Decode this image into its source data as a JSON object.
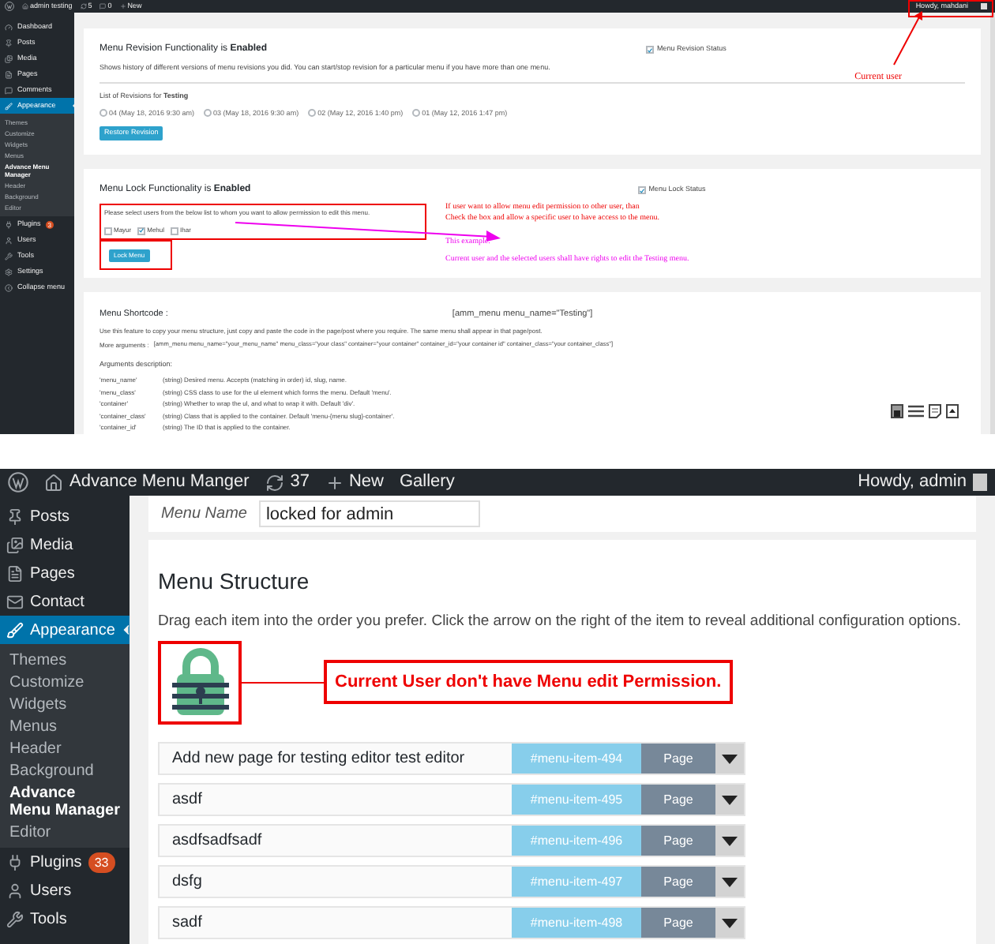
{
  "top_screenshot": {
    "admin_bar": {
      "site": "admin testing",
      "updates": "5",
      "comments": "0",
      "new": "New",
      "greeting": "Howdy, mahdani"
    },
    "sidebar": {
      "items": [
        {
          "label": "Dashboard",
          "selected": false
        },
        {
          "label": "Posts",
          "selected": false
        },
        {
          "label": "Media",
          "selected": false
        },
        {
          "label": "Pages",
          "selected": false
        },
        {
          "label": "Comments",
          "selected": false
        },
        {
          "label": "Appearance",
          "selected": true,
          "children": [
            {
              "label": "Themes",
              "selected": false
            },
            {
              "label": "Customize",
              "selected": false
            },
            {
              "label": "Widgets",
              "selected": false
            },
            {
              "label": "Menus",
              "selected": false
            },
            {
              "label": "Advance Menu Manager",
              "selected": true
            },
            {
              "label": "Header",
              "selected": false
            },
            {
              "label": "Background",
              "selected": false
            },
            {
              "label": "Editor",
              "selected": false
            }
          ]
        },
        {
          "label": "Plugins",
          "selected": false,
          "badge": "3"
        },
        {
          "label": "Users",
          "selected": false
        },
        {
          "label": "Tools",
          "selected": false
        },
        {
          "label": "Settings",
          "selected": false
        },
        {
          "label": "Collapse menu",
          "selected": false
        }
      ]
    },
    "revision_panel": {
      "title": "Menu Revision Functionality is **Enabled**",
      "status_label": "Menu Revision Status",
      "status_checked": true,
      "description": "Shows history of different versions of menu revisions you did. You can start/stop revision for a particular menu if you have more than one menu.",
      "list_label": "List of Revisions for **Testing**",
      "revisions": [
        {
          "label": "04 (May 18, 2016 9:30 am)",
          "selected": false
        },
        {
          "label": "03 (May 18, 2016 9:30 am)",
          "selected": false
        },
        {
          "label": "02 (May 12, 2016 1:40 pm)",
          "selected": false
        },
        {
          "label": "01 (May 12, 2016 1:47 pm)",
          "selected": false
        }
      ],
      "button": "Restore Revision"
    },
    "current_user_note": "Current user",
    "lock_panel": {
      "title": "Menu Lock Functionality is **Enabled**",
      "status_label": "Menu Lock Status",
      "status_checked": true,
      "instruction": "Please select users from the below list to whom you want to allow permission to edit this menu.",
      "users": [
        {
          "label": "Mayur",
          "checked": false
        },
        {
          "label": "Mehul",
          "checked": true
        },
        {
          "label": "Ihar",
          "checked": false
        }
      ],
      "button": "Lock Menu",
      "note_lines": [
        "If user want to allow menu edit permission to other user, than",
        "Check the box and allow a specific user to have access to the menu."
      ],
      "example_title": "This example:",
      "example_text": "Current user and the selected users shall have rights to edit the Testing menu."
    },
    "shortcode_panel": {
      "title": "Menu Shortcode :",
      "shortcode": "[amm_menu menu_name=\"Testing\"]",
      "description": "Use this feature to copy your menu structure, just copy and paste the code in the page/post where you require. The same menu shall appear in that page/post.",
      "more_label": "More arguments :",
      "more_text": "[amm_menu menu_name=\"your_menu_name\" menu_class=\"your class\" container=\"your container\" container_id=\"your container id\" container_class=\"your container_class\"]",
      "arguments_title": "Arguments description:",
      "arguments": [
        {
          "name": "'menu_name'",
          "text": "(string) Desired menu. Accepts (matching in order) id, slug, name."
        },
        {
          "name": "'menu_class'",
          "text": "(string) CSS class to use for the ul element which forms the menu. Default 'menu'."
        },
        {
          "name": "'container'",
          "text": "(string) Whether to wrap the ul, and what to wrap it with. Default 'div'."
        },
        {
          "name": "'container_class'",
          "text": "(string) Class that is applied to the container. Default 'menu-{menu slug}-container'."
        },
        {
          "name": "'container_id'",
          "text": "(string) The ID that is applied to the container."
        }
      ]
    }
  },
  "bottom_screenshot": {
    "admin_bar": {
      "site": "Advance Menu Manger",
      "updates": "37",
      "new": "New",
      "gallery": "Gallery",
      "greeting": "Howdy, admin"
    },
    "sidebar": {
      "items": [
        {
          "label": "Posts",
          "selected": false
        },
        {
          "label": "Media",
          "selected": false
        },
        {
          "label": "Pages",
          "selected": false
        },
        {
          "label": "Contact",
          "selected": false
        },
        {
          "label": "Appearance",
          "selected": true,
          "children": [
            {
              "label": "Themes",
              "selected": false
            },
            {
              "label": "Customize",
              "selected": false
            },
            {
              "label": "Widgets",
              "selected": false
            },
            {
              "label": "Menus",
              "selected": false
            },
            {
              "label": "Header",
              "selected": false
            },
            {
              "label": "Background",
              "selected": false
            },
            {
              "label": "Advance Menu Manager",
              "selected": true
            },
            {
              "label": "Editor",
              "selected": false
            }
          ]
        },
        {
          "label": "Plugins",
          "selected": false,
          "badge": "33"
        },
        {
          "label": "Users",
          "selected": false
        },
        {
          "label": "Tools",
          "selected": false
        }
      ]
    },
    "menu_name_label": "Menu Name",
    "menu_name_value": "locked for admin",
    "structure_title": "Menu Structure",
    "structure_description": "Drag each item into the order you prefer. Click the arrow on the right of the item to reveal additional configuration options.",
    "callout": "Current User don't have Menu edit Permission.",
    "menu_items": [
      {
        "title": "Add new page for testing editor test editor",
        "id": "#menu-item-494",
        "type": "Page"
      },
      {
        "title": "asdf",
        "id": "#menu-item-495",
        "type": "Page"
      },
      {
        "title": "asdfsadfsadf",
        "id": "#menu-item-496",
        "type": "Page"
      },
      {
        "title": "dsfg",
        "id": "#menu-item-497",
        "type": "Page"
      },
      {
        "title": "sadf",
        "id": "#menu-item-498",
        "type": "Page"
      }
    ]
  }
}
